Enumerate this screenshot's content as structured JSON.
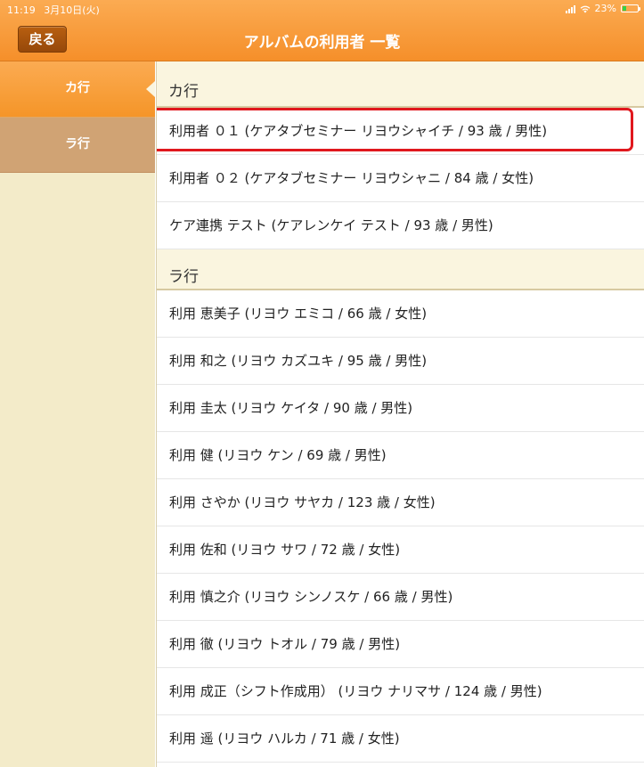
{
  "status_bar": {
    "time": "11:19",
    "date": "3月10日(火)",
    "battery": "23%",
    "battery_level": 0.23
  },
  "nav": {
    "back_label": "戻る",
    "title": "アルバムの利用者 一覧"
  },
  "sidebar": {
    "items": [
      {
        "label": "カ行",
        "active": true
      },
      {
        "label": "ラ行",
        "active": false
      }
    ]
  },
  "sections": [
    {
      "header": "カ行",
      "rows": [
        "利用者 ０１ (ケアタブセミナー リヨウシャイチ / 93 歳 / 男性)",
        "利用者 ０２ (ケアタブセミナー リヨウシャニ / 84 歳 / 女性)",
        "ケア連携 テスト (ケアレンケイ テスト / 93 歳 / 男性)"
      ]
    },
    {
      "header": "ラ行",
      "rows": [
        "利用 恵美子 (リヨウ エミコ / 66 歳 / 女性)",
        "利用 和之 (リヨウ カズユキ / 95 歳 / 男性)",
        "利用 圭太 (リヨウ ケイタ / 90 歳 / 男性)",
        "利用 健 (リヨウ ケン / 69 歳 / 男性)",
        "利用 さやか (リヨウ サヤカ / 123 歳 / 女性)",
        "利用 佐和 (リヨウ サワ / 72 歳 / 女性)",
        "利用 慎之介 (リヨウ シンノスケ / 66 歳 / 男性)",
        "利用 徹 (リヨウ トオル / 79 歳 / 男性)",
        "利用 成正（シフト作成用） (リヨウ ナリマサ / 124 歳 / 男性)",
        "利用 遥 (リヨウ ハルカ / 71 歳 / 女性)"
      ]
    }
  ],
  "highlighted_row": "利用者 ０１ (ケアタブセミナー リヨウシャイチ / 93 歳 / 男性)",
  "colors": {
    "nav_orange": "#f58f2a",
    "back_button": "#a8540d",
    "sidebar_bg": "#f3ebc9",
    "sidebar_inactive": "#d0a374",
    "highlight_border": "#e0181e"
  }
}
